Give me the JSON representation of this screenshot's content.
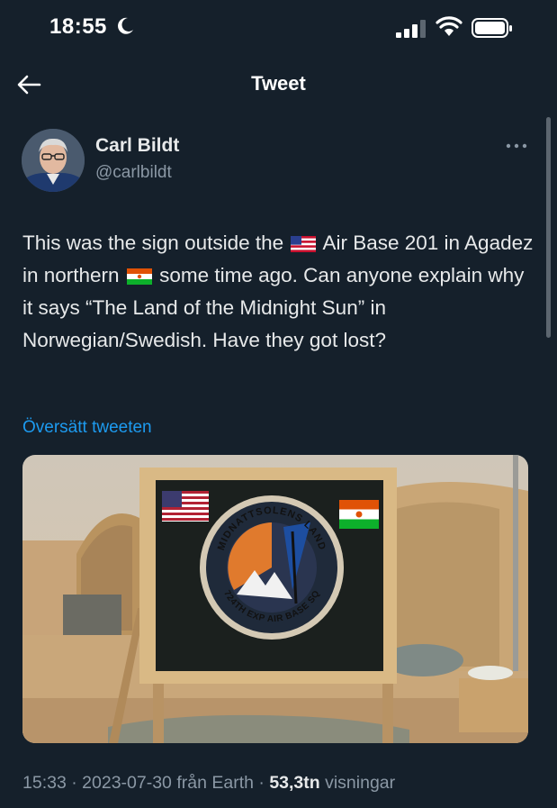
{
  "status_bar": {
    "time": "18:55"
  },
  "nav": {
    "title": "Tweet"
  },
  "author": {
    "name": "Carl Bildt",
    "handle": "@carlbildt"
  },
  "tweet": {
    "text_part1": "This was the sign outside the",
    "flag1": "US flag",
    "text_part2": "Air Base 201 in Agadez in northern",
    "flag2": "Niger flag",
    "text_part3": "some time ago. Can anyone explain why it says “The Land of the Midnight Sun” in Norwegian/Swedish. Have they got lost?"
  },
  "translate_label": "Översätt tweeten",
  "media": {
    "sign_top_text": "MIDNATTSOLENS LAND",
    "sign_bottom_text": "724TH EXP AIR BASE SQ"
  },
  "meta": {
    "time": "15:33",
    "date": "2023-07-30",
    "source_prefix": "från",
    "source": "Earth",
    "views": "53,3tn",
    "views_label": "visningar"
  },
  "colors": {
    "background": "#15202b",
    "accent": "#1d9bf0",
    "secondary": "#8b98a5"
  }
}
